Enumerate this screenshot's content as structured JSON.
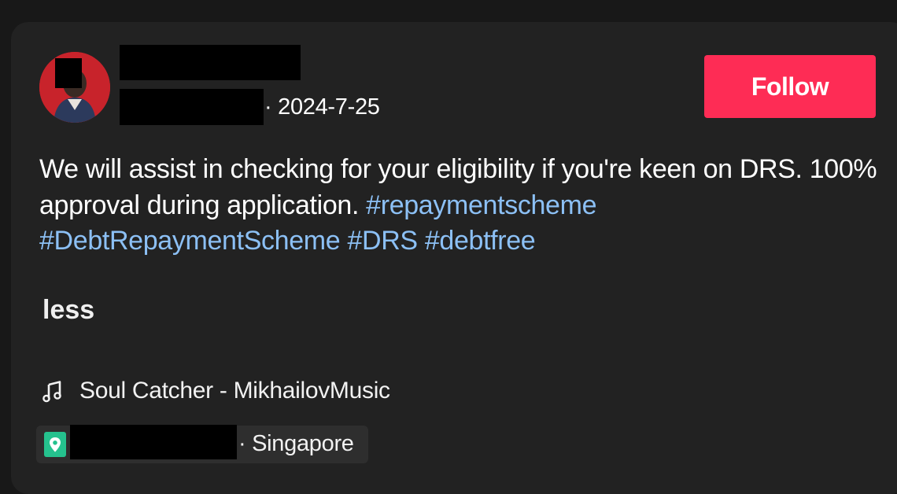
{
  "post": {
    "date": "· 2024-7-25",
    "follow_label": "Follow",
    "caption": {
      "text": "We will assist in checking for your eligibility if you're keen on DRS. 100% approval during application.",
      "hashtags": [
        "#repaymentscheme",
        "#DebtRepaymentScheme",
        "#DRS",
        "#debtfree"
      ]
    },
    "less_label": "less",
    "music": {
      "icon": "music-note-icon",
      "title": "Soul Catcher - MikhailovMusic"
    },
    "location": {
      "icon": "location-pin-icon",
      "place": "· Singapore"
    }
  },
  "colors": {
    "background": "#181818",
    "card": "#222222",
    "follow_button": "#fe2c55",
    "hashtag": "#8cc0f5",
    "avatar": "#c8232b",
    "pin": "#25c28e"
  }
}
